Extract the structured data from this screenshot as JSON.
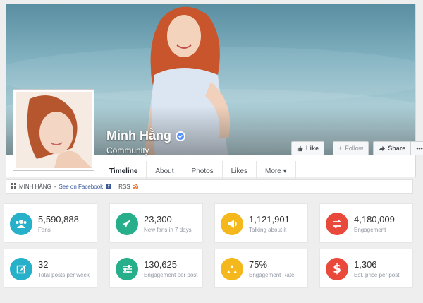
{
  "profile": {
    "name": "Minh Hằng",
    "category": "Community"
  },
  "actions": {
    "like_label": "Like",
    "follow_label": "Follow",
    "share_label": "Share",
    "more_label": "•••"
  },
  "tabs": [
    {
      "label": "Timeline"
    },
    {
      "label": "About"
    },
    {
      "label": "Photos"
    },
    {
      "label": "Likes"
    },
    {
      "label": "More ▾"
    }
  ],
  "infobar": {
    "page_name": "MINH HẰNG",
    "separator": " - ",
    "see_on_facebook": "See on Facebook",
    "fb_glyph": "f",
    "rss": "RSS"
  },
  "stats": [
    {
      "value": "5,590,888",
      "label": "Fans",
      "color": "#26b0c9",
      "icon": "users-icon"
    },
    {
      "value": "23,300",
      "label": "New fans in 7 days",
      "color": "#27ae8a",
      "icon": "rocket-icon"
    },
    {
      "value": "1,121,901",
      "label": "Talking about it",
      "color": "#f4b81c",
      "icon": "megaphone-icon"
    },
    {
      "value": "4,180,009",
      "label": "Engagement",
      "color": "#e9493a",
      "icon": "exchange-icon"
    },
    {
      "value": "32",
      "label": "Total posts per week",
      "color": "#26b0c9",
      "icon": "edit-icon"
    },
    {
      "value": "130,625",
      "label": "Engagement per post",
      "color": "#27ae8a",
      "icon": "sliders-icon"
    },
    {
      "value": "75%",
      "label": "Engagement Rate",
      "color": "#f4b81c",
      "icon": "recycle-icon"
    },
    {
      "value": "1,306",
      "label": "Est. price per post",
      "color": "#e9493a",
      "icon": "dollar-icon"
    }
  ]
}
